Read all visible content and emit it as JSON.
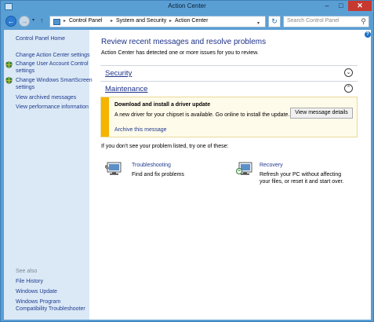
{
  "window": {
    "title": "Action Center",
    "minimize": "–",
    "maximize": "□",
    "close": "✕"
  },
  "nav": {
    "back": "←",
    "forward": "→",
    "recent": "▾",
    "up": "↑",
    "breadcrumbs": [
      "Control Panel",
      "System and Security",
      "Action Center"
    ],
    "crumb_separator": "▸",
    "address_dropdown": "▾",
    "refresh": "↻",
    "search_placeholder": "Search Control Panel",
    "search_glyph": "⚲"
  },
  "sidebar": {
    "home": "Control Panel Home",
    "items": [
      "Change Action Center settings",
      "Change User Account Control settings",
      "Change Windows SmartScreen settings",
      "View archived messages",
      "View performance information"
    ],
    "uac_lines": [
      "Change User Account Control",
      "settings"
    ],
    "smartscreen_lines": [
      "Change Windows SmartScreen",
      "settings"
    ],
    "see_also_heading": "See also",
    "see_also": [
      "File History",
      "Windows Update"
    ],
    "compat_lines": [
      "Windows Program",
      "Compatibility Troubleshooter"
    ]
  },
  "main": {
    "help": "?",
    "title": "Review recent messages and resolve problems",
    "subtitle": "Action Center has detected one or more issues for you to review.",
    "sections": [
      {
        "label": "Security",
        "chevron": "⌄"
      },
      {
        "label": "Maintenance",
        "chevron": "⌃"
      }
    ],
    "alert": {
      "title": "Download and install a driver update",
      "body": "A new driver for your chipset is available. Go online to install the update.",
      "link": "Archive this message",
      "button": "View message details"
    },
    "hint": "If you don't see your problem listed, try one of these:",
    "troubleshooting": {
      "title": "Troubleshooting",
      "desc": "Find and fix problems"
    },
    "recovery": {
      "title": "Recovery",
      "desc_lines": [
        "Refresh your PC without affecting",
        "your files, or reset it and start over."
      ]
    }
  },
  "colors": {
    "frame": "#5a9fd4",
    "sidebar": "#dbe9f6",
    "link": "#1f3b8f",
    "alert_bar": "#f4b400"
  }
}
